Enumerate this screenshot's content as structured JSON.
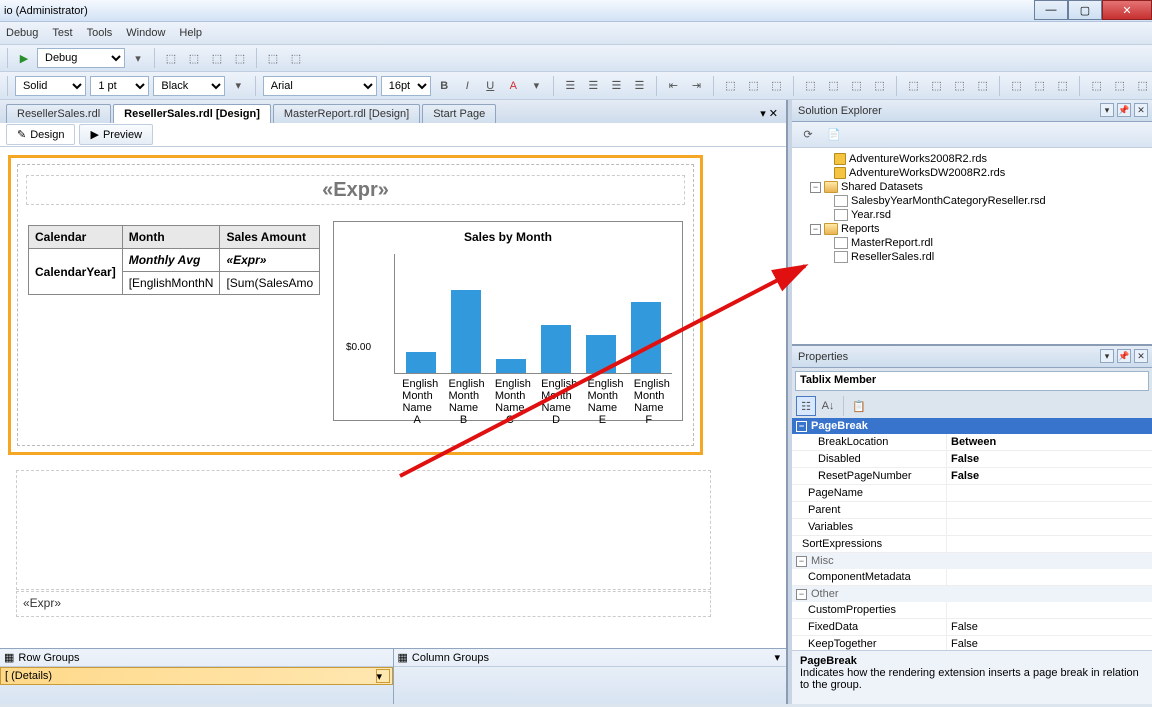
{
  "window": {
    "title": "io (Administrator)"
  },
  "menu": {
    "debug": "Debug",
    "test": "Test",
    "tools": "Tools",
    "window": "Window",
    "help": "Help"
  },
  "toolbar": {
    "config": "Debug"
  },
  "format": {
    "border_style": "Solid",
    "border_width": "1 pt",
    "border_color": "Black",
    "font_name": "Arial",
    "font_size": "16pt"
  },
  "doc_tabs": {
    "t1": "ResellerSales.rdl",
    "t2": "ResellerSales.rdl [Design]",
    "t3": "MasterReport.rdl [Design]",
    "t4": "Start Page"
  },
  "subtabs": {
    "design": "Design",
    "preview": "Preview"
  },
  "report": {
    "title_expr": "«Expr»",
    "col_calendar": "Calendar",
    "col_month": "Month",
    "col_amount": "Sales Amount",
    "row_yr": "CalendarYear]",
    "row_avg": "Monthly Avg",
    "row_avg_val": "«Expr»",
    "row_mn": "[EnglishMonthN",
    "row_sum": "[Sum(SalesAmo",
    "footer": "«Expr»"
  },
  "chart_data": {
    "type": "bar",
    "title": "Sales by Month",
    "ylabel": "$0.00",
    "categories": [
      "English Month Name A",
      "English Month Name B",
      "English Month Name C",
      "English Month Name D",
      "English Month Name E",
      "English Month Name F"
    ],
    "values": [
      18,
      70,
      12,
      40,
      32,
      60
    ]
  },
  "groups": {
    "row_hdr": "Row Groups",
    "col_hdr": "Column Groups",
    "details": "[ (Details)"
  },
  "solution": {
    "header": "Solution Explorer",
    "items": {
      "ds1": "AdventureWorks2008R2.rds",
      "ds2": "AdventureWorksDW2008R2.rds",
      "shared": "Shared Datasets",
      "dset1": "SalesbyYearMonthCategoryReseller.rsd",
      "dset2": "Year.rsd",
      "reports": "Reports",
      "rpt1": "MasterReport.rdl",
      "rpt2": "ResellerSales.rdl"
    }
  },
  "props": {
    "header": "Properties",
    "object": "Tablix Member",
    "cat_pagebreak": "PageBreak",
    "break_loc_k": "BreakLocation",
    "break_loc_v": "Between",
    "disabled_k": "Disabled",
    "disabled_v": "False",
    "reset_k": "ResetPageNumber",
    "reset_v": "False",
    "pagename_k": "PageName",
    "parent_k": "Parent",
    "vars_k": "Variables",
    "sortexp_k": "SortExpressions",
    "cat_misc": "Misc",
    "compmeta_k": "ComponentMetadata",
    "cat_other": "Other",
    "custprop_k": "CustomProperties",
    "fixed_k": "FixedData",
    "fixed_v": "False",
    "keep_k": "KeepTogether",
    "keep_v": "False",
    "desc_title": "PageBreak",
    "desc_text": "Indicates how the rendering extension inserts a page break in relation to the group."
  }
}
